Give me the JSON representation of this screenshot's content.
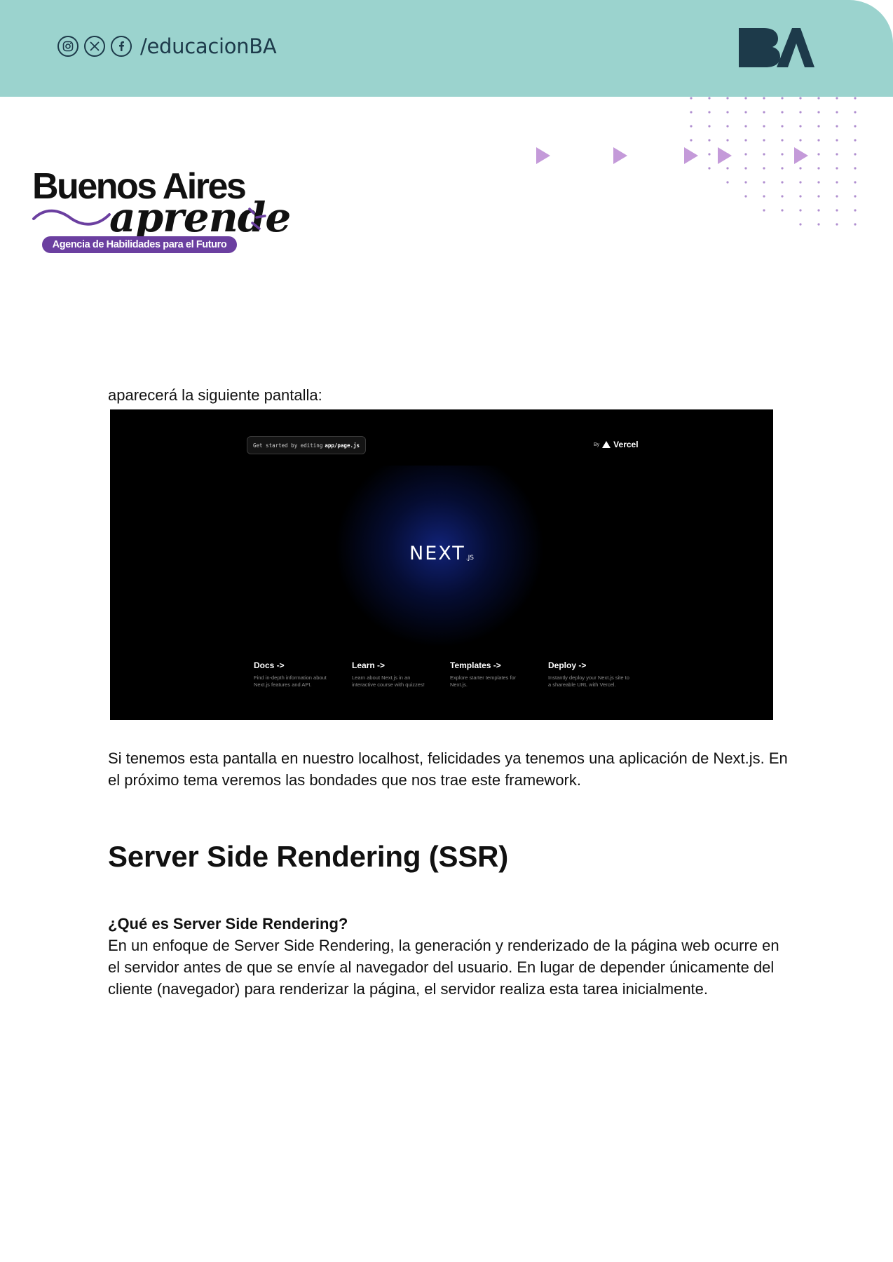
{
  "header": {
    "social_handle": "/educacionBA",
    "icons": [
      "instagram-icon",
      "x-icon",
      "facebook-icon"
    ],
    "logo_text": "BA",
    "colors": {
      "band": "#9bd3ce",
      "logo": "#1d3a4a",
      "accent_purple": "#6b3fa0"
    }
  },
  "brand": {
    "title": "Buenos Aires",
    "script": "aprende",
    "tagline": "Agencia de Habilidades para el Futuro"
  },
  "content": {
    "intro": "aparecerá la siguiente pantalla:",
    "after_screenshot": "Si tenemos esta pantalla en nuestro localhost, felicidades ya tenemos una aplicación de Next.js. En el próximo tema veremos las bondades que nos trae este framework.",
    "heading": "Server Side Rendering (SSR)",
    "subheading": "¿Qué es Server Side Rendering?",
    "ssr_body": "En un enfoque de Server Side Rendering, la generación y renderizado de la página web ocurre en el servidor antes de que se envíe al navegador del usuario. En lugar de depender únicamente del cliente (navegador) para renderizar la página, el servidor realiza esta tarea inicialmente."
  },
  "screenshot": {
    "get_started_prefix": "Get started by editing",
    "get_started_file": "app/page.js",
    "by": "By",
    "vercel": "Vercel",
    "logo": "NEXT",
    "logo_suffix": ".JS",
    "cards": [
      {
        "title": "Docs ->",
        "desc": "Find in-depth information about Next.js features and API."
      },
      {
        "title": "Learn ->",
        "desc": "Learn about Next.js in an interactive course with quizzes!"
      },
      {
        "title": "Templates ->",
        "desc": "Explore starter templates for Next.js."
      },
      {
        "title": "Deploy ->",
        "desc": "Instantly deploy your Next.js site to a shareable URL with Vercel."
      }
    ]
  }
}
